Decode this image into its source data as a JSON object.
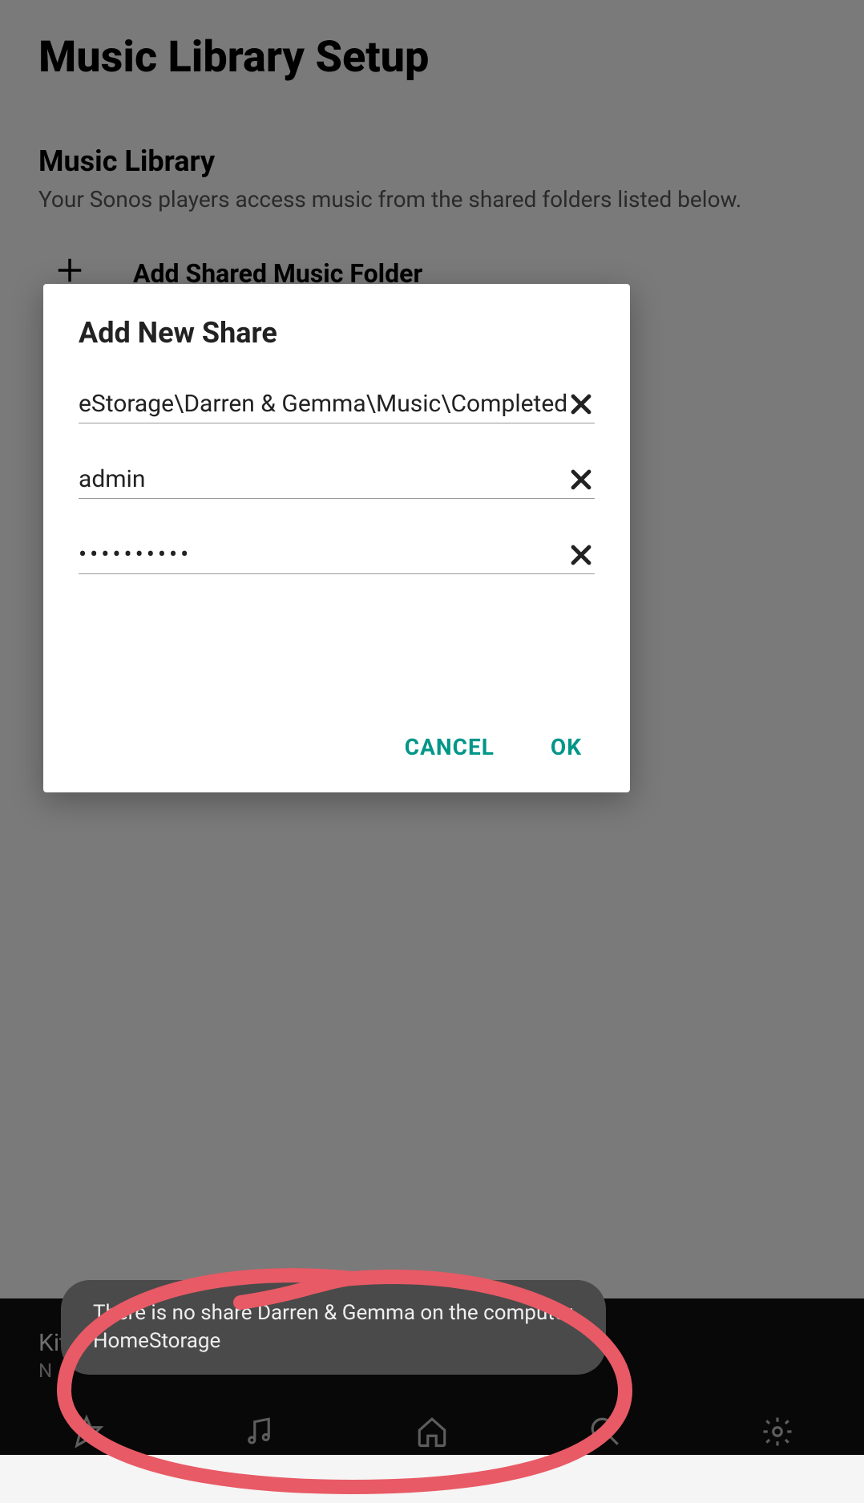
{
  "page": {
    "title": "Music Library Setup",
    "section_title": "Music Library",
    "section_desc": "Your Sonos players access music from the shared folders listed below.",
    "add_folder_label": "Add Shared Music Folder"
  },
  "dialog": {
    "title": "Add New Share",
    "path_value": "eStorage\\Darren & Gemma\\Music\\Completed",
    "username_value": "admin",
    "password_value": "••••••••••",
    "cancel_label": "CANCEL",
    "ok_label": "OK"
  },
  "toast": {
    "message": "There is no share Darren & Gemma on the computer HomeStorage"
  },
  "bottom": {
    "room": "Kitchen",
    "sub": "N"
  },
  "icons": {
    "plus": "＋",
    "clear": "close-icon",
    "nav": [
      "star",
      "music",
      "home",
      "search",
      "gear"
    ]
  },
  "colors": {
    "accent": "#009688"
  }
}
